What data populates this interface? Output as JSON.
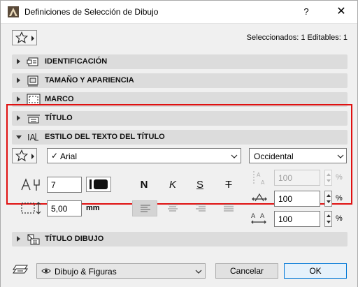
{
  "window": {
    "title": "Definiciones de Selección de Dibujo",
    "help_label": "?",
    "close_label": "✕"
  },
  "header": {
    "selection_info": "Seleccionados: 1 Editables: 1"
  },
  "panels": [
    {
      "label": "IDENTIFICACIÓN",
      "expanded": false
    },
    {
      "label": "TAMAÑO Y APARIENCIA",
      "expanded": false
    },
    {
      "label": "MARCO",
      "expanded": false
    },
    {
      "label": "TÍTULO",
      "expanded": false
    },
    {
      "label": "ESTILO DEL TEXTO DEL TÍTULO",
      "expanded": true
    },
    {
      "label": "TÍTULO DIBUJO",
      "expanded": false
    }
  ],
  "text_style": {
    "font_check": "✓",
    "font_name": "Arial",
    "script": "Occidental",
    "pen_number": "7",
    "text_size": "5,00",
    "text_size_unit": "mm",
    "bold_label": "N",
    "italic_label": "K",
    "underline_label": "S",
    "strikethrough_label": "T",
    "line_spacing": "100",
    "line_spacing_unit": "%",
    "width_factor": "100",
    "width_factor_unit": "%",
    "char_spacing": "100",
    "char_spacing_unit": "%",
    "active_alignment": "left"
  },
  "footer": {
    "layer_set": "Dibujo & Figuras",
    "cancel_label": "Cancelar",
    "ok_label": "OK"
  },
  "colors": {
    "highlight_border": "#e01010",
    "panel_bg": "#dcdcdc",
    "primary_border": "#0078d7"
  }
}
